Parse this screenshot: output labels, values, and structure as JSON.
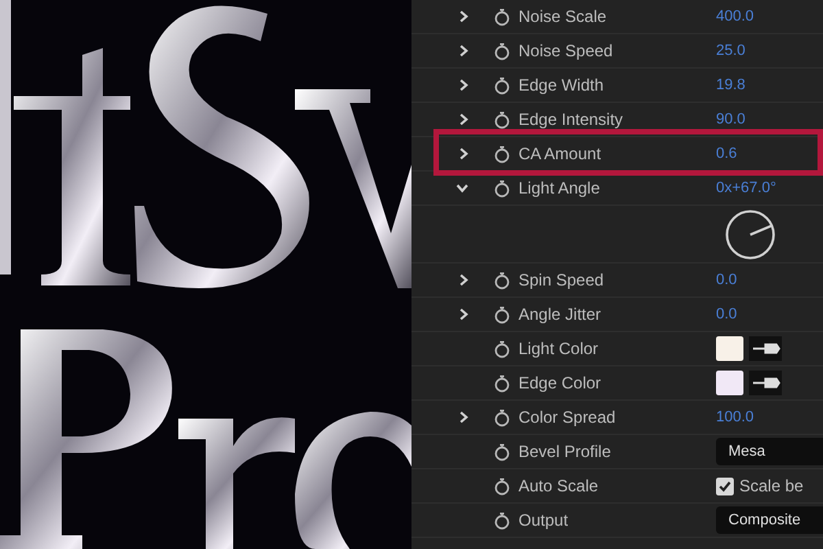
{
  "properties": [
    {
      "label": "Noise Scale",
      "expandable": true,
      "expanded": false,
      "kind": "number",
      "value": "400.0"
    },
    {
      "label": "Noise Speed",
      "expandable": true,
      "expanded": false,
      "kind": "number",
      "value": "25.0"
    },
    {
      "label": "Edge Width",
      "expandable": true,
      "expanded": false,
      "kind": "number",
      "value": "19.8"
    },
    {
      "label": "Edge Intensity",
      "expandable": true,
      "expanded": false,
      "kind": "number",
      "value": "90.0"
    },
    {
      "label": "CA Amount",
      "expandable": true,
      "expanded": false,
      "kind": "number",
      "value": "0.6",
      "highlighted": true
    },
    {
      "label": "Light Angle",
      "expandable": true,
      "expanded": true,
      "kind": "angle",
      "value": "0x+67.0°"
    },
    {
      "label": "Spin Speed",
      "expandable": true,
      "expanded": false,
      "kind": "number",
      "value": "0.0"
    },
    {
      "label": "Angle Jitter",
      "expandable": true,
      "expanded": false,
      "kind": "number",
      "value": "0.0"
    },
    {
      "label": "Light Color",
      "expandable": false,
      "kind": "color",
      "color": "#f8f1e8"
    },
    {
      "label": "Edge Color",
      "expandable": false,
      "kind": "color",
      "color": "#f1e8f6"
    },
    {
      "label": "Color Spread",
      "expandable": true,
      "expanded": false,
      "kind": "number",
      "value": "100.0"
    },
    {
      "label": "Bevel Profile",
      "expandable": false,
      "kind": "dropdown",
      "value": "Mesa"
    },
    {
      "label": "Auto Scale",
      "expandable": false,
      "kind": "checkbox",
      "checked": true,
      "value": "Scale be"
    },
    {
      "label": "Output",
      "expandable": false,
      "kind": "dropdown",
      "value": "Composite"
    }
  ]
}
